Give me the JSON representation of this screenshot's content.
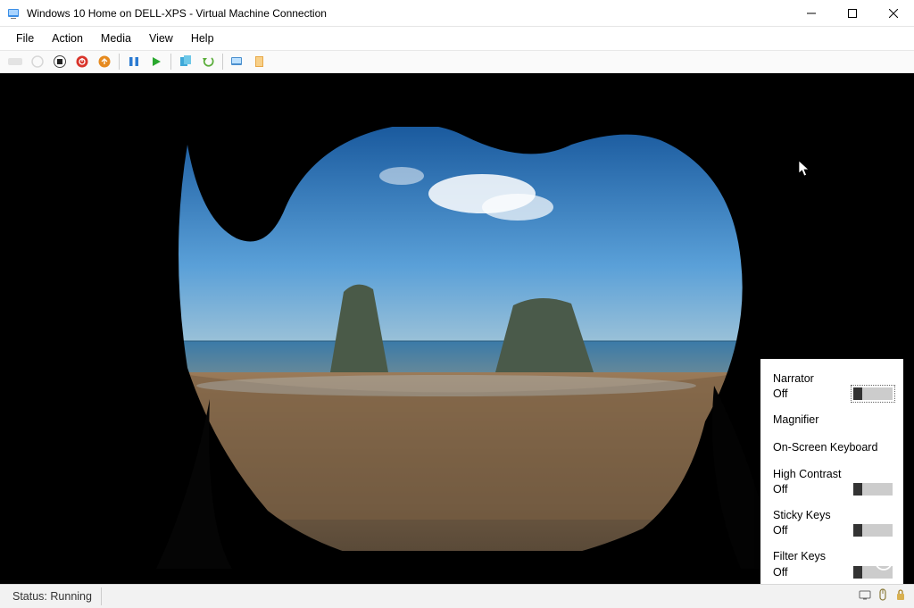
{
  "window": {
    "title": "Windows 10 Home on DELL-XPS - Virtual Machine Connection"
  },
  "menus": {
    "file": "File",
    "action": "Action",
    "media": "Media",
    "view": "View",
    "help": "Help"
  },
  "toolbar_icons": {
    "ctrl_alt_del": "ctrl-alt-del-icon",
    "power": "power-icon",
    "stop": "stop-icon",
    "shutdown": "shutdown-icon",
    "save": "save-icon",
    "pause": "pause-icon",
    "start": "start-icon",
    "checkpoint": "checkpoint-icon",
    "revert": "revert-icon",
    "basic_session": "basic-session-icon",
    "enhanced_session": "enhanced-session-icon"
  },
  "accessibility": {
    "narrator": {
      "label": "Narrator",
      "state": "Off"
    },
    "magnifier": {
      "label": "Magnifier"
    },
    "osk": {
      "label": "On-Screen Keyboard"
    },
    "high_contrast": {
      "label": "High Contrast",
      "state": "Off"
    },
    "sticky_keys": {
      "label": "Sticky Keys",
      "state": "Off"
    },
    "filter_keys": {
      "label": "Filter Keys",
      "state": "Off"
    }
  },
  "status": {
    "text": "Status: Running"
  }
}
